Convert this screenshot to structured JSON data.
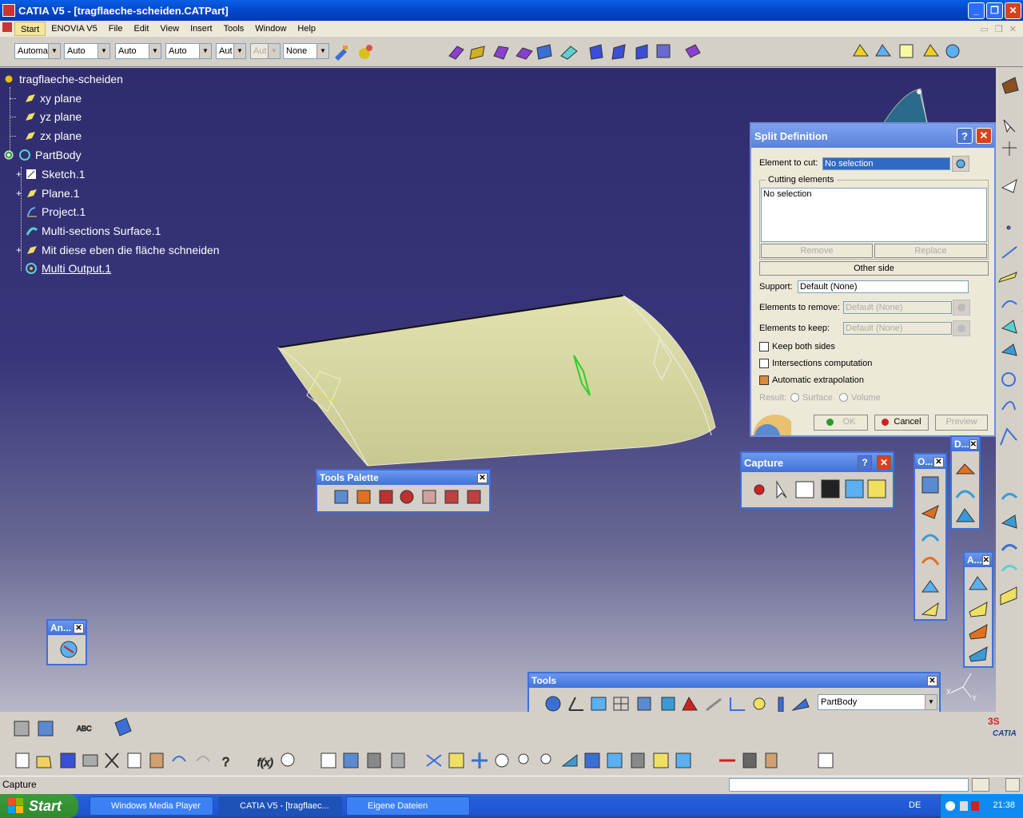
{
  "window": {
    "title": "CATIA V5 - [tragflaeche-scheiden.CATPart]",
    "minimize": "_",
    "restore": "❐",
    "close": "✕"
  },
  "menu": {
    "items": [
      "Start",
      "ENOVIA V5",
      "File",
      "Edit",
      "View",
      "Insert",
      "Tools",
      "Window",
      "Help"
    ]
  },
  "toolbar_top": {
    "combos": [
      "Automa",
      "Auto",
      "Auto",
      "Auto",
      "Aut",
      "Aut",
      "None"
    ]
  },
  "tree": {
    "root": "tragflaeche-scheiden",
    "items": [
      "xy plane",
      "yz plane",
      "zx plane",
      "PartBody",
      "Sketch.1",
      "Plane.1",
      "Project.1",
      "Multi-sections Surface.1",
      "Mit diese eben die fläche schneiden",
      "Multi Output.1"
    ]
  },
  "split_dialog": {
    "title": "Split Definition",
    "help": "?",
    "close": "✕",
    "element_to_cut_label": "Element to cut:",
    "element_to_cut_value": "No selection",
    "cutting_elements_label": "Cutting elements",
    "cutting_elements_value": "No selection",
    "remove": "Remove",
    "replace": "Replace",
    "other_side": "Other side",
    "support_label": "Support:",
    "support_value": "Default (None)",
    "elements_to_remove_label": "Elements to remove:",
    "elements_to_remove_value": "Default (None)",
    "elements_to_keep_label": "Elements to keep:",
    "elements_to_keep_value": "Default (None)",
    "keep_both_sides": "Keep both sides",
    "intersections_computation": "Intersections computation",
    "automatic_extrapolation": "Automatic extrapolation",
    "result_label": "Result:",
    "result_surface": "Surface",
    "result_volume": "Volume",
    "ok": "OK",
    "cancel": "Cancel",
    "preview": "Preview"
  },
  "panels": {
    "tools_palette": "Tools Palette",
    "capture": "Capture",
    "tools": "Tools",
    "tools_combo": "PartBody",
    "an": "An...",
    "o": "O...",
    "d": "D...",
    "a": "A...",
    "close": "✕",
    "help": "?"
  },
  "status": {
    "text": "Capture"
  },
  "taskbar": {
    "start": "Start",
    "tasks": [
      "Windows Media Player",
      "CATIA V5 - [tragflaec...",
      "Eigene Dateien"
    ],
    "lang": "DE",
    "time": "21:38"
  },
  "colors": {
    "viewport_top": "#2f2c6e",
    "surface": "#d8d8a0",
    "xp_blue": "#245edb"
  }
}
